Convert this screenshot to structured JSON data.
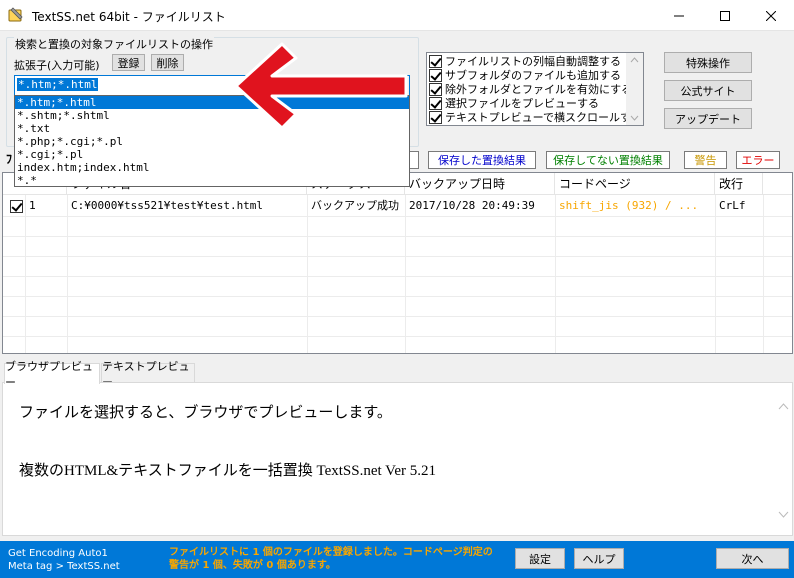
{
  "window": {
    "title": "TextSS.net 64bit - ファイルリスト"
  },
  "group": {
    "title": "検索と置換の対象ファイルリストの操作",
    "ext_label": "拡張子(入力可能)",
    "register_label": "登録",
    "delete_label": "削除",
    "combo_value": "*.htm;*.html",
    "dropdown_options": [
      "*.htm;*.html",
      "*.shtm;*.shtml",
      "*.txt",
      "*.php;*.cgi;*.pl",
      "*.cgi;*.pl",
      "index.htm;index.html",
      "*.*"
    ]
  },
  "options": [
    "ファイルリストの列幅自動調整する",
    "サブフォルダのファイルも追加する",
    "除外フォルダとファイルを有効にする",
    "選択ファイルをプレビューする",
    "テキストプレビューで横スクロールする"
  ],
  "right_buttons": {
    "special": "特殊操作",
    "official": "公式サイト",
    "update": "アップデート"
  },
  "status_buttons": {
    "saved": "保存した置換結果",
    "unsaved": "保存してない置換結果",
    "warning": "警告",
    "error": "エラー"
  },
  "left_mark": "ﾌ",
  "grid": {
    "headers": [
      "",
      "ファイル名",
      "ステータス",
      "バックアップ日時",
      "コードページ",
      "改行"
    ],
    "rows": [
      {
        "no": "1",
        "file": "C:¥0000¥tss521¥test¥test.html",
        "status": "バックアップ成功",
        "backup_time": "2017/10/28 20:49:39",
        "codepage": "shift_jis (932) / ...",
        "newline": "CrLf"
      }
    ]
  },
  "tabs": {
    "browser": "ブラウザプレビュー",
    "text": "テキストプレビュー"
  },
  "preview": {
    "line1": "ファイルを選択すると、ブラウザでプレビューします。",
    "line2": "複数のHTML&テキストファイルを一括置換 TextSS.net Ver 5.21"
  },
  "statusbar": {
    "encoding_line1": "Get Encoding Auto1",
    "encoding_line2": "Meta tag > TextSS.net",
    "message": "ファイルリストに 1 個のファイルを登録しました。コードページ判定の警告が 1 個、失敗が 0 個あります。",
    "settings_label": "設定",
    "help_label": "ヘルプ",
    "next_label": "次へ"
  },
  "colors": {
    "accent": "#0078d7",
    "warning_text": "#f7a600",
    "arrow": "#e0131e",
    "saved": "#0000cc",
    "unsaved": "#008000",
    "warn": "#c89600",
    "error": "#e00000"
  }
}
